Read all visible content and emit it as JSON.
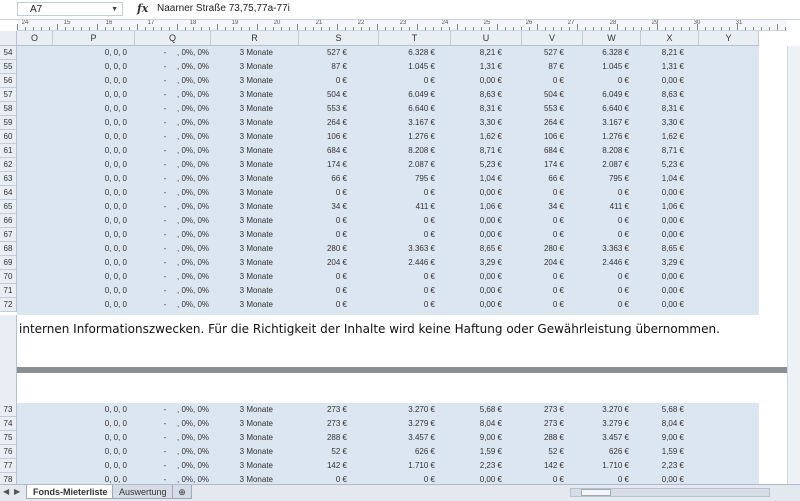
{
  "formula_bar": {
    "name_box": "A7",
    "fx_label": "fx",
    "formula": "Naarner Straße 73,75,77a-77i"
  },
  "ruler_labels": [
    "24",
    "15",
    "16",
    "17",
    "18",
    "19",
    "20",
    "21",
    "22",
    "23",
    "24",
    "25",
    "26",
    "27",
    "28",
    "29",
    "30",
    "31"
  ],
  "columns": [
    "O",
    "P",
    "Q",
    "R",
    "S",
    "T",
    "U",
    "V",
    "W",
    "X",
    "Y"
  ],
  "rows_top": [
    {
      "n": "54",
      "p": "0, 0, 0",
      "q1": "-",
      "q2": ", 0%, 0%",
      "r": "3 Monate",
      "s": "527 €",
      "t": "6.328 €",
      "u": "8,21 €",
      "v": "527 €",
      "w": "6.328 €",
      "x": "8,21 €"
    },
    {
      "n": "55",
      "p": "0, 0, 0",
      "q1": "-",
      "q2": ", 0%, 0%",
      "r": "3 Monate",
      "s": "87 €",
      "t": "1.045 €",
      "u": "1,31 €",
      "v": "87 €",
      "w": "1.045 €",
      "x": "1,31 €"
    },
    {
      "n": "56",
      "p": "0, 0, 0",
      "q1": "-",
      "q2": ", 0%, 0%",
      "r": "3 Monate",
      "s": "0 €",
      "t": "0 €",
      "u": "0,00 €",
      "v": "0 €",
      "w": "0 €",
      "x": "0,00 €"
    },
    {
      "n": "57",
      "p": "0, 0, 0",
      "q1": "-",
      "q2": ", 0%, 0%",
      "r": "3 Monate",
      "s": "504 €",
      "t": "6.049 €",
      "u": "8,63 €",
      "v": "504 €",
      "w": "6.049 €",
      "x": "8,63 €"
    },
    {
      "n": "58",
      "p": "0, 0, 0",
      "q1": "-",
      "q2": ", 0%, 0%",
      "r": "3 Monate",
      "s": "553 €",
      "t": "6.640 €",
      "u": "8,31 €",
      "v": "553 €",
      "w": "6.640 €",
      "x": "8,31 €"
    },
    {
      "n": "59",
      "p": "0, 0, 0",
      "q1": "-",
      "q2": ", 0%, 0%",
      "r": "3 Monate",
      "s": "264 €",
      "t": "3.167 €",
      "u": "3,30 €",
      "v": "264 €",
      "w": "3.167 €",
      "x": "3,30 €"
    },
    {
      "n": "60",
      "p": "0, 0, 0",
      "q1": "-",
      "q2": ", 0%, 0%",
      "r": "3 Monate",
      "s": "106 €",
      "t": "1.276 €",
      "u": "1,62 €",
      "v": "106 €",
      "w": "1.276 €",
      "x": "1,62 €"
    },
    {
      "n": "61",
      "p": "0, 0, 0",
      "q1": "-",
      "q2": ", 0%, 0%",
      "r": "3 Monate",
      "s": "684 €",
      "t": "8.208 €",
      "u": "8,71 €",
      "v": "684 €",
      "w": "8.208 €",
      "x": "8,71 €"
    },
    {
      "n": "62",
      "p": "0, 0, 0",
      "q1": "-",
      "q2": ", 0%, 0%",
      "r": "3 Monate",
      "s": "174 €",
      "t": "2.087 €",
      "u": "5,23 €",
      "v": "174 €",
      "w": "2.087 €",
      "x": "5,23 €"
    },
    {
      "n": "63",
      "p": "0, 0, 0",
      "q1": "-",
      "q2": ", 0%, 0%",
      "r": "3 Monate",
      "s": "66 €",
      "t": "795 €",
      "u": "1,04 €",
      "v": "66 €",
      "w": "795 €",
      "x": "1,04 €"
    },
    {
      "n": "64",
      "p": "0, 0, 0",
      "q1": "-",
      "q2": ", 0%, 0%",
      "r": "3 Monate",
      "s": "0 €",
      "t": "0 €",
      "u": "0,00 €",
      "v": "0 €",
      "w": "0 €",
      "x": "0,00 €"
    },
    {
      "n": "65",
      "p": "0, 0, 0",
      "q1": "-",
      "q2": ", 0%, 0%",
      "r": "3 Monate",
      "s": "34 €",
      "t": "411 €",
      "u": "1,06 €",
      "v": "34 €",
      "w": "411 €",
      "x": "1,06 €"
    },
    {
      "n": "66",
      "p": "0, 0, 0",
      "q1": "-",
      "q2": ", 0%, 0%",
      "r": "3 Monate",
      "s": "0 €",
      "t": "0 €",
      "u": "0,00 €",
      "v": "0 €",
      "w": "0 €",
      "x": "0,00 €"
    },
    {
      "n": "67",
      "p": "0, 0, 0",
      "q1": "-",
      "q2": ", 0%, 0%",
      "r": "3 Monate",
      "s": "0 €",
      "t": "0 €",
      "u": "0,00 €",
      "v": "0 €",
      "w": "0 €",
      "x": "0,00 €"
    },
    {
      "n": "68",
      "p": "0, 0, 0",
      "q1": "-",
      "q2": ", 0%, 0%",
      "r": "3 Monate",
      "s": "280 €",
      "t": "3.363 €",
      "u": "8,65 €",
      "v": "280 €",
      "w": "3.363 €",
      "x": "8,65 €"
    },
    {
      "n": "69",
      "p": "0, 0, 0",
      "q1": "-",
      "q2": ", 0%, 0%",
      "r": "3 Monate",
      "s": "204 €",
      "t": "2.446 €",
      "u": "3,29 €",
      "v": "204 €",
      "w": "2.446 €",
      "x": "3,29 €"
    },
    {
      "n": "70",
      "p": "0, 0, 0",
      "q1": "-",
      "q2": ", 0%, 0%",
      "r": "3 Monate",
      "s": "0 €",
      "t": "0 €",
      "u": "0,00 €",
      "v": "0 €",
      "w": "0 €",
      "x": "0,00 €"
    },
    {
      "n": "71",
      "p": "0, 0, 0",
      "q1": "-",
      "q2": ", 0%, 0%",
      "r": "3 Monate",
      "s": "0 €",
      "t": "0 €",
      "u": "0,00 €",
      "v": "0 €",
      "w": "0 €",
      "x": "0,00 €"
    },
    {
      "n": "72",
      "p": "0, 0, 0",
      "q1": "-",
      "q2": ", 0%, 0%",
      "r": "3 Monate",
      "s": "0 €",
      "t": "0 €",
      "u": "0,00 €",
      "v": "0 €",
      "w": "0 €",
      "x": "0,00 €"
    }
  ],
  "disclaimer": "internen Informationszwecken. Für die Richtigkeit der Inhalte wird keine Haftung oder Gewährleistung übernommen.",
  "rows_bottom": [
    {
      "n": "73",
      "p": "0, 0, 0",
      "q1": "-",
      "q2": ", 0%, 0%",
      "r": "3 Monate",
      "s": "273 €",
      "t": "3.270 €",
      "u": "5,68 €",
      "v": "273 €",
      "w": "3.270 €",
      "x": "5,68 €"
    },
    {
      "n": "74",
      "p": "0, 0, 0",
      "q1": "-",
      "q2": ", 0%, 0%",
      "r": "3 Monate",
      "s": "273 €",
      "t": "3.279 €",
      "u": "8,04 €",
      "v": "273 €",
      "w": "3.279 €",
      "x": "8,04 €"
    },
    {
      "n": "75",
      "p": "0, 0, 0",
      "q1": "-",
      "q2": ", 0%, 0%",
      "r": "3 Monate",
      "s": "288 €",
      "t": "3.457 €",
      "u": "9,00 €",
      "v": "288 €",
      "w": "3.457 €",
      "x": "9,00 €"
    },
    {
      "n": "76",
      "p": "0, 0, 0",
      "q1": "-",
      "q2": ", 0%, 0%",
      "r": "3 Monate",
      "s": "52 €",
      "t": "626 €",
      "u": "1,59 €",
      "v": "52 €",
      "w": "626 €",
      "x": "1,59 €"
    },
    {
      "n": "77",
      "p": "0, 0, 0",
      "q1": "-",
      "q2": ", 0%, 0%",
      "r": "3 Monate",
      "s": "142 €",
      "t": "1.710 €",
      "u": "2,23 €",
      "v": "142 €",
      "w": "1.710 €",
      "x": "2,23 €"
    },
    {
      "n": "78",
      "p": "0, 0, 0",
      "q1": "-",
      "q2": ", 0%, 0%",
      "r": "3 Monate",
      "s": "0 €",
      "t": "0 €",
      "u": "0,00 €",
      "v": "0 €",
      "w": "0 €",
      "x": "0,00 €"
    }
  ],
  "sheet_tabs": [
    {
      "label": "Fonds-Mieterliste",
      "active": true
    },
    {
      "label": "Auswertung",
      "active": false
    }
  ],
  "colors": {
    "cell_fill": "#dce6f1",
    "header_fill": "#e9eef5",
    "page_break": "#8c8f95"
  }
}
